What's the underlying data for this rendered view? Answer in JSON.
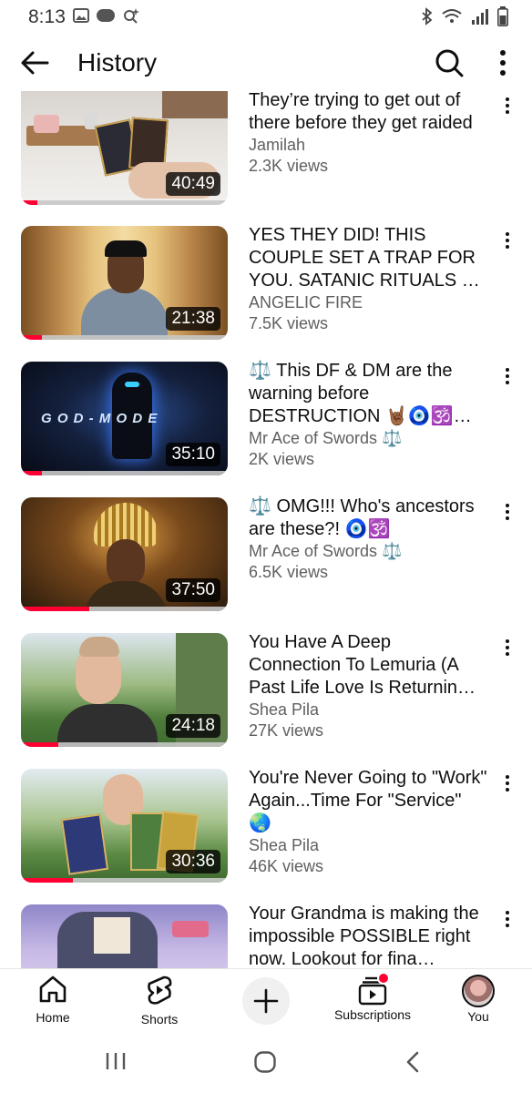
{
  "status_bar": {
    "time": "8:13",
    "left_icons": [
      "gallery-icon",
      "news-icon",
      "smart-search-icon"
    ],
    "right_icons": [
      "bluetooth-icon",
      "wifi-icon",
      "signal-icon",
      "battery-icon"
    ]
  },
  "header": {
    "title": "History",
    "icons": [
      "back-arrow-icon",
      "search-icon",
      "more-vertical-icon"
    ]
  },
  "videos": [
    {
      "title": "They’re trying to get out of there before they get raided",
      "channel": "Jamilah",
      "views": "2.3K views",
      "duration": "40:49",
      "watched_fraction": 0.08
    },
    {
      "title": "YES THEY DID! THIS COUPLE SET A TRAP FOR YOU. SATANIC RITUALS  …",
      "channel": "ANGELIC FIRE",
      "views": "7.5K views",
      "duration": "21:38",
      "watched_fraction": 0.1
    },
    {
      "title": "⚖️ This DF & DM are the warning before DESTRUCTION 🤘🏾🧿🕉️ R…",
      "channel": "Mr Ace of Swords ⚖️",
      "views": "2K views",
      "duration": "35:10",
      "watched_fraction": 0.1
    },
    {
      "title": "⚖️ OMG!!! Who's ancestors are these?! 🧿🕉️",
      "channel": "Mr Ace of Swords ⚖️",
      "views": "6.5K views",
      "duration": "37:50",
      "watched_fraction": 0.33
    },
    {
      "title": "You Have A Deep Connection To Lemuria (A Past Life Love Is Returnin…",
      "channel": "Shea Pila",
      "views": "27K views",
      "duration": "24:18",
      "watched_fraction": 0.18
    },
    {
      "title": "You're Never Going to \"Work\" Again...Time For \"Service\" 🌏",
      "channel": "Shea Pila",
      "views": "46K views",
      "duration": "30:36",
      "watched_fraction": 0.25
    },
    {
      "title": "Your Grandma is making the impossible POSSIBLE right now. Lookout for fina…",
      "channel": "",
      "views": "",
      "duration": "",
      "watched_fraction": 0
    }
  ],
  "thumbnail_texts": {
    "god_mode": "G O D - M O D E"
  },
  "bottom_nav": {
    "home": "Home",
    "shorts": "Shorts",
    "subscriptions": "Subscriptions",
    "you": "You"
  },
  "colors": {
    "accent": "#ff0033",
    "text_primary": "#0f0f0f",
    "text_secondary": "#606060"
  }
}
